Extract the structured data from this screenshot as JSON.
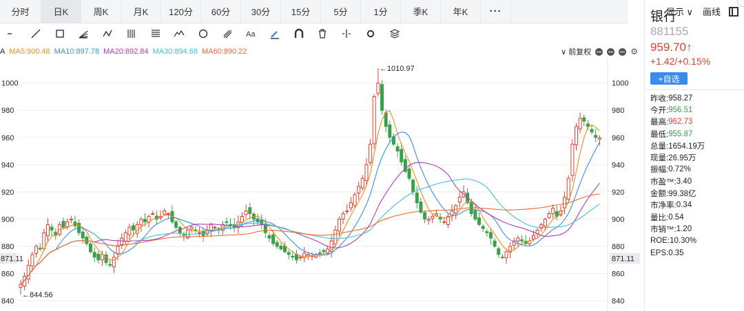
{
  "tabs": [
    "分时",
    "日K",
    "周K",
    "月K",
    "120分",
    "60分",
    "30分",
    "15分",
    "5分",
    "1分",
    "季K",
    "年K",
    "···"
  ],
  "header": {
    "display_label": "显示 ∨",
    "draw_label": "画线"
  },
  "indicators": {
    "prefix": "A",
    "items": [
      {
        "label": "MA5:900.48",
        "color": "#f08c1c"
      },
      {
        "label": "MA10:897.78",
        "color": "#3a8de0"
      },
      {
        "label": "MA20:892.84",
        "color": "#b23ab8"
      },
      {
        "label": "MA30:894.68",
        "color": "#3fc0d8"
      },
      {
        "label": "MA60:890.22",
        "color": "#ef6a2c"
      }
    ]
  },
  "controls": {
    "adjust_label": "∨ 前复权"
  },
  "stock": {
    "name": "银行",
    "code": "881155",
    "price": "959.70↑",
    "change": "+1.42/+0.15%",
    "add_button": "+自选"
  },
  "stats": [
    {
      "label": "昨收:",
      "value": "958.27",
      "tone": "ne"
    },
    {
      "label": "今开:",
      "value": "956.51",
      "tone": "dn"
    },
    {
      "label": "最高:",
      "value": "962.73",
      "tone": "up"
    },
    {
      "label": "最低:",
      "value": "955.87",
      "tone": "dn"
    },
    {
      "label": "总量:",
      "value": "1654.19万",
      "tone": "ne"
    },
    {
      "label": "现量:",
      "value": "26.95万",
      "tone": "ne"
    },
    {
      "label": "振幅:",
      "value": "0.72%",
      "tone": "ne"
    },
    {
      "label": "市盈™:",
      "value": "3.40",
      "tone": "ne"
    },
    {
      "label": "金额:",
      "value": "99.38亿",
      "tone": "ne"
    },
    {
      "label": "市净率:",
      "value": "0.34",
      "tone": "ne"
    },
    {
      "label": "量比:",
      "value": "0.54",
      "tone": "ne"
    },
    {
      "label": "市销™:",
      "value": "1.20",
      "tone": "ne"
    },
    {
      "label": "ROE:",
      "value": "10.30%",
      "tone": "ne"
    },
    {
      "label": "EPS:",
      "value": "0.35",
      "tone": "ne"
    }
  ],
  "colors": {
    "up": "#e03e2d",
    "down": "#3aa14a",
    "ma5": "#f08c1c",
    "ma10": "#3a8de0",
    "ma20": "#b23ab8",
    "ma30": "#3fc0d8",
    "ma60": "#ef6a2c"
  },
  "chart_data": {
    "type": "candlestick",
    "y_ticks": [
      840,
      860,
      880,
      900,
      920,
      940,
      960,
      980,
      1000
    ],
    "ylim": [
      836,
      1016
    ],
    "current_price_label": "871.11",
    "annotations": [
      {
        "text": "←1010.97",
        "value": 1010.97
      },
      {
        "text": "←844.56",
        "value": 844.56
      }
    ],
    "series_closes": [
      852,
      858,
      866,
      874,
      880,
      878,
      890,
      896,
      892,
      888,
      896,
      894,
      898,
      900,
      895,
      890,
      886,
      882,
      876,
      872,
      870,
      874,
      868,
      866,
      872,
      880,
      886,
      890,
      894,
      892,
      896,
      900,
      898,
      902,
      904,
      900,
      902,
      906,
      904,
      898,
      894,
      890,
      888,
      892,
      894,
      892,
      890,
      888,
      892,
      896,
      894,
      892,
      896,
      898,
      896,
      894,
      898,
      902,
      906,
      904,
      900,
      898,
      896,
      890,
      886,
      882,
      880,
      878,
      876,
      874,
      872,
      870,
      872,
      875,
      874,
      873,
      874,
      875,
      876,
      878,
      884,
      892,
      900,
      904,
      906,
      912,
      918,
      924,
      930,
      940,
      955,
      990,
      1000,
      980,
      968,
      960,
      955,
      950,
      942,
      935,
      930,
      920,
      912,
      905,
      900,
      900,
      902,
      904,
      900,
      898,
      902,
      906,
      910,
      916,
      920,
      912,
      904,
      900,
      896,
      893,
      890,
      886,
      880,
      874,
      872,
      876,
      880,
      884,
      886,
      884,
      882,
      884,
      888,
      892,
      896,
      900,
      904,
      908,
      902,
      906,
      916,
      930,
      955,
      968,
      974,
      972,
      968,
      964,
      960,
      959.7
    ]
  }
}
